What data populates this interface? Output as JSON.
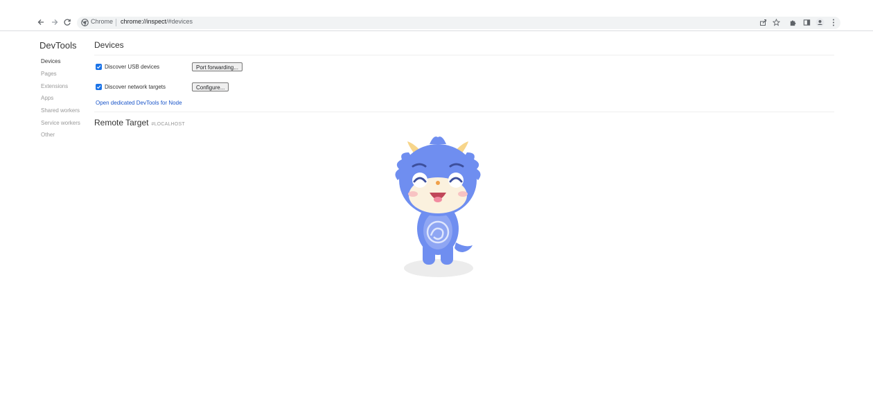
{
  "browser": {
    "origin_label": "Chrome",
    "url_host": "chrome://inspect",
    "url_path": "/#devices",
    "icons": [
      "back-arrow-icon",
      "forward-arrow-icon",
      "reload-icon",
      "share-icon",
      "bookmark-star-icon",
      "extensions-puzzle-icon",
      "side-panel-icon",
      "profile-icon",
      "kebab-menu-icon"
    ]
  },
  "sidebar": {
    "title": "DevTools",
    "items": [
      {
        "label": "Devices",
        "active": true
      },
      {
        "label": "Pages",
        "active": false
      },
      {
        "label": "Extensions",
        "active": false
      },
      {
        "label": "Apps",
        "active": false
      },
      {
        "label": "Shared workers",
        "active": false
      },
      {
        "label": "Service workers",
        "active": false
      },
      {
        "label": "Other",
        "active": false
      }
    ]
  },
  "devices": {
    "title": "Devices",
    "discover_usb": {
      "label": "Discover USB devices",
      "checked": true
    },
    "port_forwarding_button": "Port forwarding...",
    "discover_network": {
      "label": "Discover network targets",
      "checked": true
    },
    "configure_button": "Configure...",
    "node_link": "Open dedicated DevTools for Node"
  },
  "remote": {
    "title": "Remote Target",
    "subtitle": "#LOCALHOST"
  },
  "colors": {
    "accent": "#1a73e8",
    "link": "#1a55c9",
    "mascot_body": "#6f8ef0",
    "mascot_horn": "#f7d58a"
  }
}
